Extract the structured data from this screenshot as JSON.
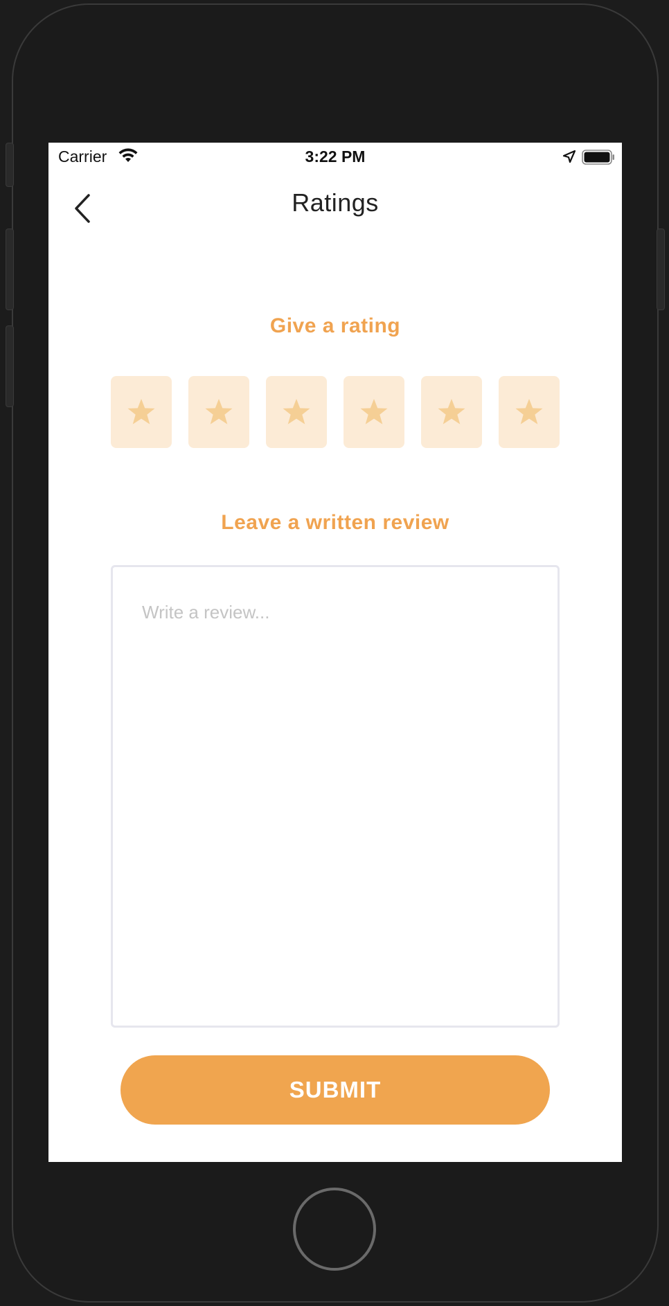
{
  "status_bar": {
    "carrier": "Carrier",
    "time": "3:22 PM",
    "icons": [
      "wifi-icon",
      "location-arrow-icon",
      "battery-icon"
    ]
  },
  "nav": {
    "title": "Ratings",
    "back_icon": "chevron-left-icon"
  },
  "rating": {
    "heading": "Give a rating",
    "star_count": 6,
    "selected": 0,
    "star_icon": "star-icon"
  },
  "review": {
    "heading": "Leave a written review",
    "value": "",
    "placeholder": "Write a review..."
  },
  "submit": {
    "label": "SUBMIT"
  },
  "colors": {
    "accent": "#f0a54f",
    "heading": "#f0a350",
    "star_box_bg": "#fcebd6",
    "star_fill": "#f5cf95",
    "input_border": "#e6e6ee",
    "placeholder": "#c4c4c4",
    "device": "#1b1b1b"
  }
}
